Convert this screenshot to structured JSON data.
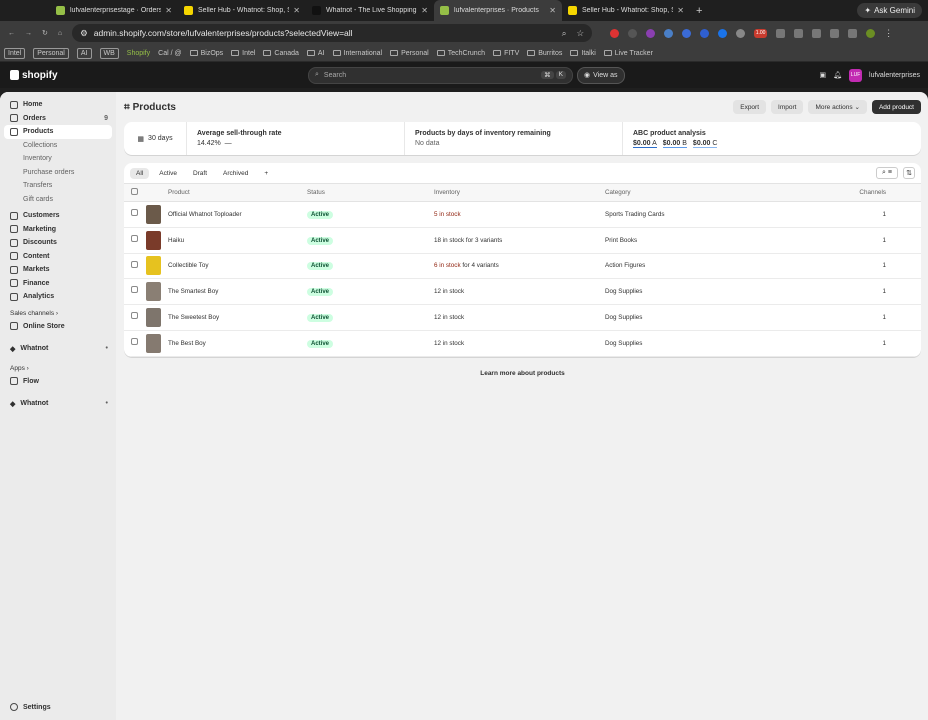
{
  "browser": {
    "tabs": [
      {
        "title": "lufvalenterprisestage · Orders",
        "color": "#95bf47",
        "active": false
      },
      {
        "title": "Seller Hub - Whatnot: Shop, S",
        "color": "#f5d600",
        "active": false
      },
      {
        "title": "Whatnot - The Live Shopping",
        "color": "#111111",
        "active": false
      },
      {
        "title": "lufvalenterprises · Products",
        "color": "#95bf47",
        "active": true
      },
      {
        "title": "Seller Hub - Whatnot: Shop, S",
        "color": "#f5d600",
        "active": false
      }
    ],
    "new_tab": "+",
    "gemini": "Ask Gemini",
    "url": "admin.shopify.com/store/lufvalenterprises/products?selectedView=all",
    "ext_badge": "1.00",
    "bookmarks": [
      "Intel",
      "Personal",
      "AI",
      "WB",
      "Shopify",
      "Cal / @",
      "BizOps",
      "Intel",
      "Canada",
      "AI",
      "International",
      "Personal",
      "TechCrunch",
      "FITV",
      "Burritos",
      "Italki",
      "Live Tracker"
    ]
  },
  "shopify": {
    "logo": "shopify",
    "search_placeholder": "Search",
    "kbd1": "⌘",
    "kbd2": "K",
    "view_as": "View as",
    "store_name": "lufvalenterprises",
    "avatar": "LUF"
  },
  "sidebar": {
    "home": "Home",
    "orders": "Orders",
    "orders_count": "9",
    "products": "Products",
    "collections": "Collections",
    "inventory": "Inventory",
    "purchase_orders": "Purchase orders",
    "transfers": "Transfers",
    "gift_cards": "Gift cards",
    "customers": "Customers",
    "marketing": "Marketing",
    "discounts": "Discounts",
    "content": "Content",
    "markets": "Markets",
    "finance": "Finance",
    "analytics": "Analytics",
    "sales_channels": "Sales channels",
    "online_store": "Online Store",
    "whatnot": "Whatnot",
    "apps": "Apps",
    "flow": "Flow",
    "whatnot2": "Whatnot",
    "settings": "Settings"
  },
  "page": {
    "title": "Products",
    "export": "Export",
    "import": "Import",
    "more_actions": "More actions",
    "add_product": "Add product"
  },
  "stats": {
    "days": "30 days",
    "sell_through_title": "Average sell-through rate",
    "sell_through_value": "14.42%",
    "sell_through_dash": "—",
    "inventory_days_title": "Products by days of inventory remaining",
    "inventory_days_value": "No data",
    "abc_title": "ABC product analysis",
    "abc": [
      {
        "value": "$0.00",
        "grade": "A"
      },
      {
        "value": "$0.00",
        "grade": "B"
      },
      {
        "value": "$0.00",
        "grade": "C"
      }
    ]
  },
  "filters": {
    "all": "All",
    "active": "Active",
    "draft": "Draft",
    "archived": "Archived",
    "add": "+"
  },
  "table": {
    "headers": {
      "product": "Product",
      "status": "Status",
      "inventory": "Inventory",
      "category": "Category",
      "channels": "Channels"
    },
    "rows": [
      {
        "name": "Official Whatnot Toploader",
        "status": "Active",
        "stock": "5 in stock",
        "variants": "",
        "low": true,
        "category": "Sports Trading Cards",
        "channels": "1",
        "thumb": "#6b5a4a"
      },
      {
        "name": "Haiku",
        "status": "Active",
        "stock": "18 in stock",
        "variants": "for 3 variants",
        "low": false,
        "category": "Print Books",
        "channels": "1",
        "thumb": "#7a3b2a"
      },
      {
        "name": "Collectible Toy",
        "status": "Active",
        "stock": "6 in stock",
        "variants": "for 4 variants",
        "low": true,
        "category": "Action Figures",
        "channels": "1",
        "thumb": "#e6c21f"
      },
      {
        "name": "The Smartest Boy",
        "status": "Active",
        "stock": "12 in stock",
        "variants": "",
        "low": false,
        "category": "Dog Supplies",
        "channels": "1",
        "thumb": "#8a7f74"
      },
      {
        "name": "The Sweetest Boy",
        "status": "Active",
        "stock": "12 in stock",
        "variants": "",
        "low": false,
        "category": "Dog Supplies",
        "channels": "1",
        "thumb": "#7e756c"
      },
      {
        "name": "The Best Boy",
        "status": "Active",
        "stock": "12 in stock",
        "variants": "",
        "low": false,
        "category": "Dog Supplies",
        "channels": "1",
        "thumb": "#857a70"
      }
    ]
  },
  "learn_more": "Learn more about products"
}
